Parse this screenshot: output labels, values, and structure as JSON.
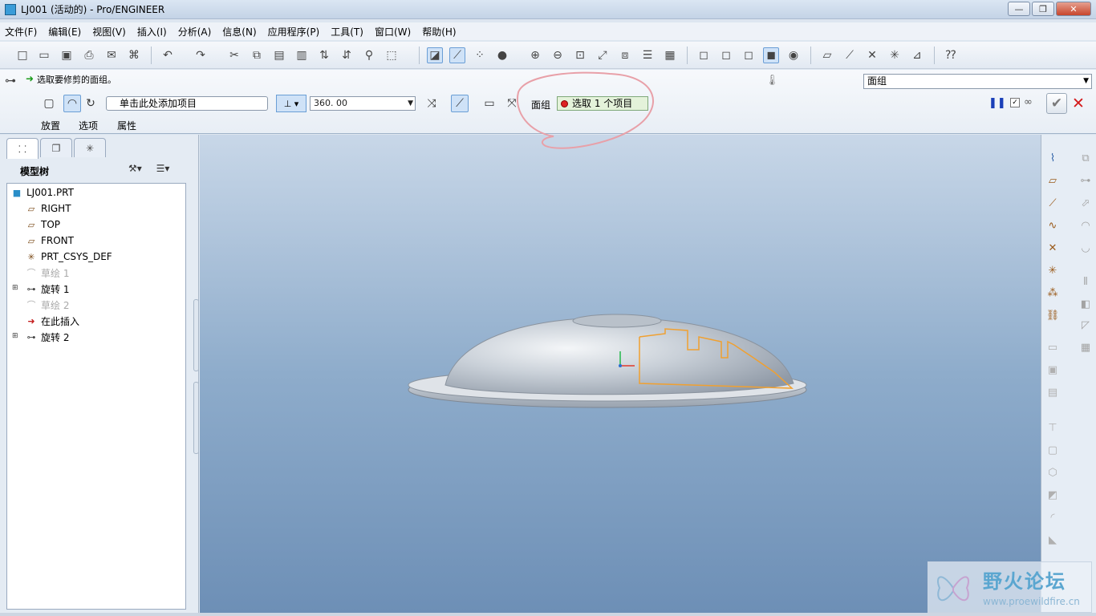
{
  "window": {
    "title": "LJ001 (活动的) - Pro/ENGINEER",
    "minimize_label": "—",
    "restore_label": "❐",
    "close_label": "✕"
  },
  "menu": {
    "items": [
      "文件(F)",
      "编辑(E)",
      "视图(V)",
      "插入(I)",
      "分析(A)",
      "信息(N)",
      "应用程序(P)",
      "工具(T)",
      "窗口(W)",
      "帮助(H)"
    ]
  },
  "dashboard": {
    "prompt": "选取要修剪的面组。",
    "filter_value": "面组",
    "add_item_placeholder": "单击此处添加项目",
    "angle_value": "360. 00",
    "quilt_label": "面组",
    "collector_text": "选取 1 个项目",
    "tabs": [
      "放置",
      "选项",
      "属性"
    ]
  },
  "model_tree": {
    "header": "模型树",
    "items": [
      {
        "label": "LJ001.PRT",
        "icon": "part-icon",
        "state": "normal"
      },
      {
        "label": "RIGHT",
        "icon": "datum-plane-icon",
        "state": "normal"
      },
      {
        "label": "TOP",
        "icon": "datum-plane-icon",
        "state": "normal"
      },
      {
        "label": "FRONT",
        "icon": "datum-plane-icon",
        "state": "normal"
      },
      {
        "label": "PRT_CSYS_DEF",
        "icon": "csys-icon",
        "state": "normal"
      },
      {
        "label": "草绘 1",
        "icon": "sketch-icon",
        "state": "grey"
      },
      {
        "label": "旋转 1",
        "icon": "revolve-icon",
        "state": "normal"
      },
      {
        "label": "草绘 2",
        "icon": "sketch-icon",
        "state": "grey"
      },
      {
        "label": "在此插入",
        "icon": "insert-here-icon",
        "state": "normal"
      },
      {
        "label": "旋转 2",
        "icon": "revolve-icon",
        "state": "normal"
      }
    ]
  },
  "watermark": {
    "title": "野火论坛",
    "url": "www.proewildfire.cn"
  },
  "colors": {
    "annotation_circle": "#e8a0a8",
    "sketch_outline": "#f0a030",
    "cancel": "#d4191a",
    "collector_bg": "#e4f2da"
  }
}
